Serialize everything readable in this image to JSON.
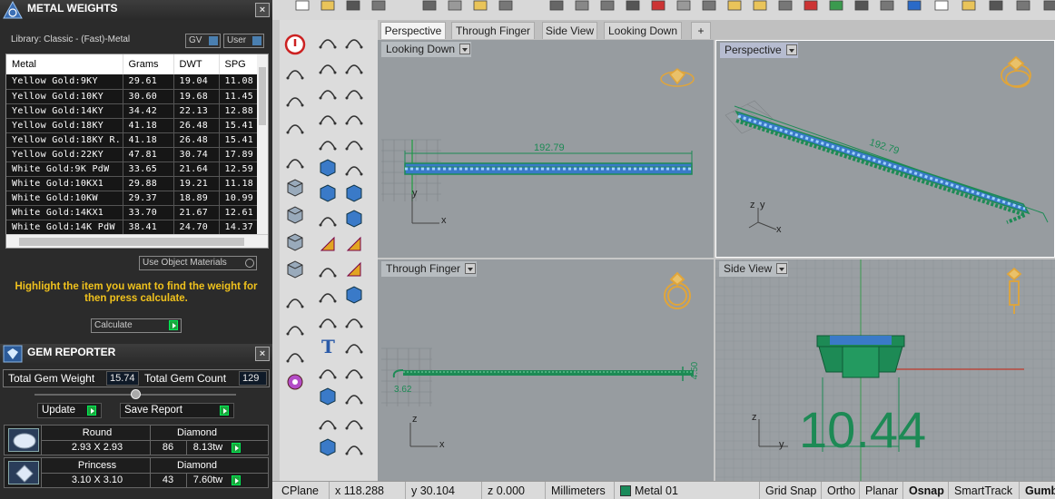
{
  "metal_weights": {
    "title": "METAL WEIGHTS",
    "close": "×",
    "library_label": "Library: Classic - (Fast)-Metal",
    "gv_button": "GV",
    "user_button": "User",
    "columns": [
      "Metal",
      "Grams",
      "DWT",
      "SPG"
    ],
    "rows": [
      [
        "Yellow Gold:9KY",
        "29.61",
        "19.04",
        "11.08"
      ],
      [
        "Yellow Gold:10KY",
        "30.60",
        "19.68",
        "11.45"
      ],
      [
        "Yellow Gold:14KY",
        "34.42",
        "22.13",
        "12.88"
      ],
      [
        "Yellow Gold:18KY",
        "41.18",
        "26.48",
        "15.41"
      ],
      [
        "Yellow Gold:18KY R...",
        "41.18",
        "26.48",
        "15.41"
      ],
      [
        "Yellow Gold:22KY",
        "47.81",
        "30.74",
        "17.89"
      ],
      [
        "White Gold:9K PdW",
        "33.65",
        "21.64",
        "12.59"
      ],
      [
        "White Gold:10KX1",
        "29.88",
        "19.21",
        "11.18"
      ],
      [
        "White Gold:10KW",
        "29.37",
        "18.89",
        "10.99"
      ],
      [
        "White Gold:14KX1",
        "33.70",
        "21.67",
        "12.61"
      ],
      [
        "White Gold:14K PdW",
        "38.41",
        "24.70",
        "14.37"
      ]
    ],
    "use_object_materials": "Use Object Materials",
    "message": "Highlight the item you want to find the weight for then press calculate.",
    "calculate": "Calculate"
  },
  "gem_reporter": {
    "title": "GEM REPORTER",
    "close": "×",
    "total_weight_label": "Total Gem Weight",
    "total_weight_value": "15.74",
    "total_count_label": "Total Gem Count",
    "total_count_value": "129",
    "update": "Update",
    "save_report": "Save Report",
    "gems": [
      {
        "shape": "Round",
        "size": "2.93 X 2.93",
        "type": "Diamond",
        "count": "86",
        "weight": "8.13tw"
      },
      {
        "shape": "Princess",
        "size": "3.10 X 3.10",
        "type": "Diamond",
        "count": "43",
        "weight": "7.60tw"
      }
    ]
  },
  "tabs": [
    "Perspective",
    "Through Finger",
    "Side View",
    "Looking Down"
  ],
  "tab_add": "+",
  "viewports": {
    "looking_down": {
      "label": "Looking Down",
      "dimension": "192.79",
      "axis_x": "x",
      "axis_y": "y"
    },
    "perspective": {
      "label": "Perspective",
      "dimension": "192.79",
      "axis_x": "x",
      "axis_y": "y",
      "axis_z": "z"
    },
    "through_finger": {
      "label": "Through Finger",
      "dim_left": "3.62",
      "dim_right": "4.50",
      "axis_x": "x",
      "axis_z": "z"
    },
    "side_view": {
      "label": "Side View",
      "dimension": "10.44",
      "axis_y": "y",
      "axis_z": "z"
    }
  },
  "status": {
    "cplane": "CPlane",
    "x": "x 118.288",
    "y": "y 30.104",
    "z": "z 0.000",
    "units": "Millimeters",
    "layer": "Metal 01",
    "layer_color": "#1a8a5a",
    "grid_snap": "Grid Snap",
    "ortho": "Ortho",
    "planar": "Planar",
    "osnap": "Osnap",
    "smarttrack": "SmartTrack",
    "gumball": "Gumb"
  },
  "colors": {
    "accent": "#f0c21d",
    "model_green": "#1d8a55",
    "model_blue": "#1e5cc8",
    "highlight_blue": "#4a7fb0"
  }
}
